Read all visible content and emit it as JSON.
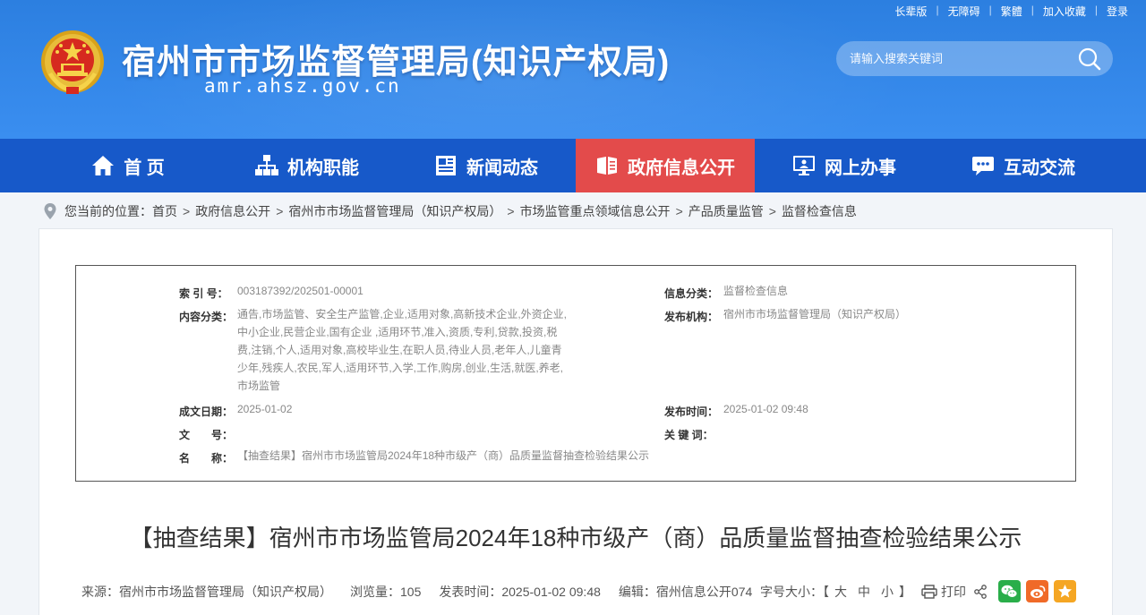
{
  "header": {
    "title": "宿州市市场监督管理局(知识产权局)",
    "domain": "amr.ahsz.gov.cn",
    "top_links": [
      "长辈版",
      "无障碍",
      "繁體",
      "加入收藏",
      "登录"
    ],
    "search_placeholder": "请输入搜索关键词"
  },
  "nav": {
    "items": [
      {
        "label": "首 页",
        "icon": "home-icon"
      },
      {
        "label": "机构职能",
        "icon": "org-chart-icon"
      },
      {
        "label": "新闻动态",
        "icon": "newspaper-icon"
      },
      {
        "label": "政府信息公开",
        "icon": "open-book-icon"
      },
      {
        "label": "网上办事",
        "icon": "monitor-icon"
      },
      {
        "label": "互动交流",
        "icon": "chat-icon"
      }
    ],
    "active_index": 3
  },
  "breadcrumb": {
    "prefix": "您当前的位置：",
    "items": [
      "首页",
      "政府信息公开",
      "宿州市市场监督管理局（知识产权局）",
      "市场监管重点领域信息公开",
      "产品质量监管",
      "监督检查信息"
    ]
  },
  "meta": {
    "index_label": "索 引 号：",
    "index_value": "003187392/202501-00001",
    "category_label": "信息分类：",
    "category_value": "监督检查信息",
    "content_label": "内容分类：",
    "content_value": "通告,市场监管、安全生产监管,企业,适用对象,高新技术企业,外资企业,中小企业,民营企业,国有企业 ,适用环节,准入,资质,专利,贷款,投资,税费,注销,个人,适用对象,高校毕业生,在职人员,待业人员,老年人,儿童青少年,残疾人,农民,军人,适用环节,入学,工作,购房,创业,生活,就医,养老,市场监管",
    "publisher_label": "发布机构：",
    "publisher_value": "宿州市市场监督管理局（知识产权局）",
    "date_label": "成文日期：",
    "date_value": "2025-01-02",
    "pubtime_label": "发布时间：",
    "pubtime_value": "2025-01-02 09:48",
    "docno_label": "文　　号：",
    "docno_value": "",
    "keywords_label": "关 键 词：",
    "keywords_value": "",
    "name_label": "名　　称：",
    "name_value": "【抽查结果】宿州市市场监管局2024年18种市级产（商）品质量监督抽查检验结果公示"
  },
  "article": {
    "title": "【抽查结果】宿州市市场监管局2024年18种市级产（商）品质量监督抽查检验结果公示",
    "source": "来源：宿州市市场监督管理局（知识产权局）",
    "views": "浏览量：105",
    "pub_time": "发表时间：2025-01-02 09:48",
    "editor": "编辑：宿州信息公开074",
    "font_size_label": "字号大小：【",
    "font_large": "大",
    "font_medium": "中",
    "font_small": "小",
    "font_size_end": "】",
    "print_label": "打印"
  },
  "colors": {
    "header_blue": "#2c7fe0",
    "nav_blue": "#1759c9",
    "nav_active_red": "#e34b4b",
    "wechat_green": "#2aae4a",
    "weibo_orange": "#f06a28",
    "favorite_yellow": "#f5a623"
  }
}
